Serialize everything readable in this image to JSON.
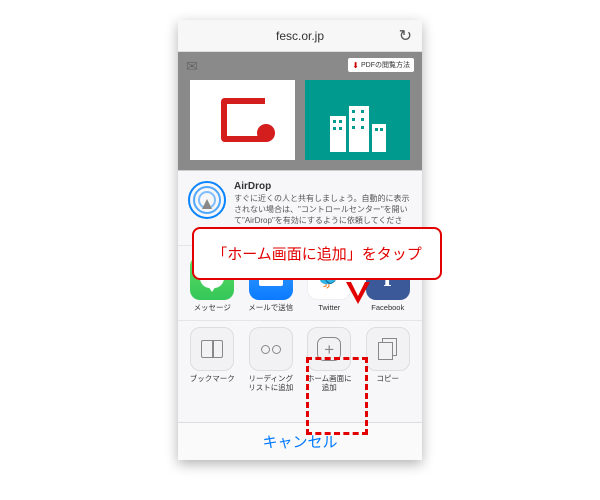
{
  "urlbar": {
    "url": "fesc.or.jp"
  },
  "page": {
    "pdf_badge": "PDFの閲覧方法"
  },
  "airdrop": {
    "title": "AirDrop",
    "desc": "すぐに近くの人と共有しましょう。自動的に表示されない場合は、\"コントロールセンター\"を開いて\"AirDrop\"を有効にするように依頼してください。"
  },
  "share_apps": [
    {
      "id": "message",
      "label": "メッセージ"
    },
    {
      "id": "mail",
      "label": "メールで送信"
    },
    {
      "id": "twitter",
      "label": "Twitter"
    },
    {
      "id": "facebook",
      "label": "Facebook"
    }
  ],
  "actions": [
    {
      "id": "bookmark",
      "label": "ブックマーク"
    },
    {
      "id": "readinglist",
      "label": "リーディングリストに追加"
    },
    {
      "id": "homescreen",
      "label": "ホーム画面に追加"
    },
    {
      "id": "copy",
      "label": "コピー"
    }
  ],
  "cancel_label": "キャンセル",
  "callout_text": "「ホーム画面に追加」をタップ",
  "colors": {
    "accent_red": "#e20000",
    "ios_blue": "#007aff"
  }
}
